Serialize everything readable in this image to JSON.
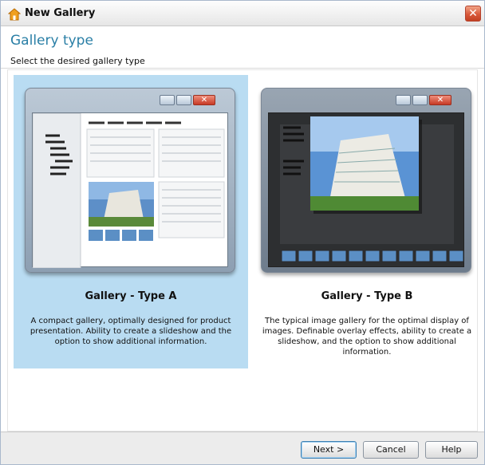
{
  "window": {
    "title": "New Gallery",
    "close_glyph": "✕"
  },
  "header": {
    "title": "Gallery type",
    "subtitle": "Select the desired gallery type"
  },
  "options": [
    {
      "title": "Gallery - Type A",
      "description": "A compact gallery, optimally designed for product presentation. Ability to create a slideshow and the option to show additional information.",
      "selected": true
    },
    {
      "title": "Gallery - Type B",
      "description": "The typical image gallery for the optimal display of images. Definable overlay effects, ability to create a slideshow, and the option to show additional information.",
      "selected": false
    }
  ],
  "buttons": {
    "next": "Next >",
    "cancel": "Cancel",
    "help": "Help"
  },
  "colors": {
    "selection": "#b9dcf2",
    "header_title": "#2a7fa6",
    "close_red": "#d9593b"
  },
  "icons": {
    "app": "house-icon",
    "close": "close-icon",
    "minimize": "minimize-icon",
    "maximize": "maximize-icon"
  }
}
